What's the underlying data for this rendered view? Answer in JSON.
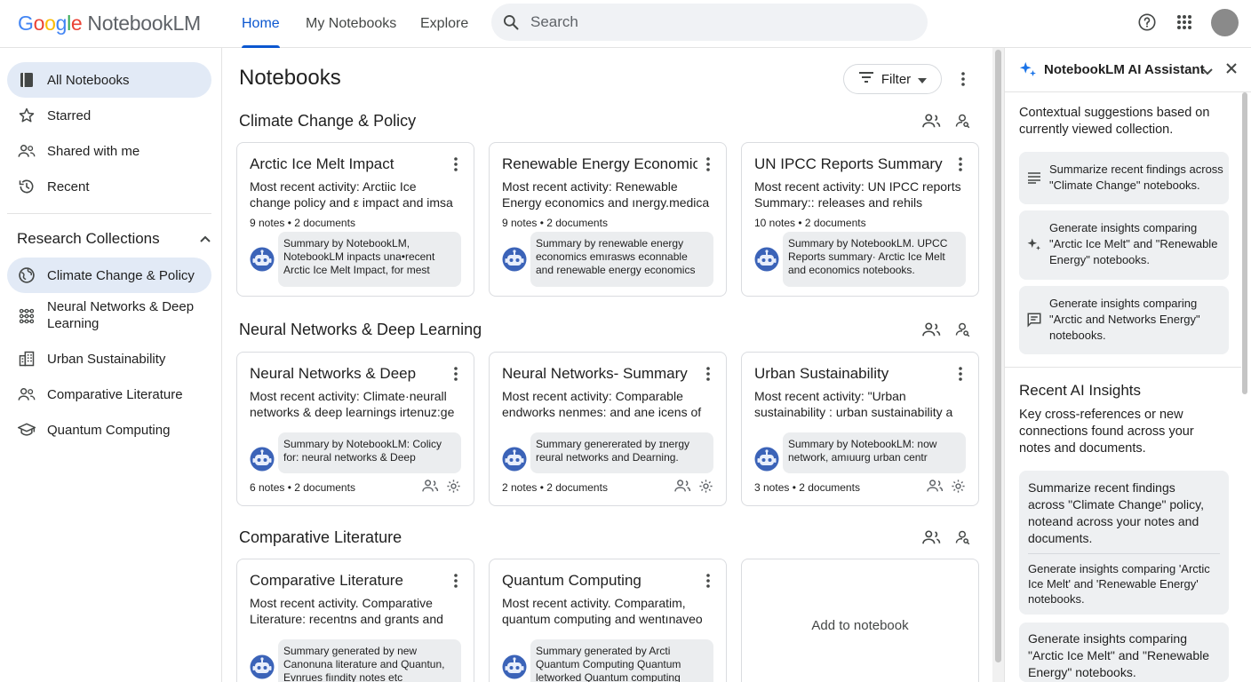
{
  "app": {
    "logo_google": "Google",
    "logo_product": "NotebookLM"
  },
  "nav": {
    "tabs": [
      {
        "label": "Home",
        "active": true
      },
      {
        "label": "My Notebooks",
        "active": false
      },
      {
        "label": "Explore",
        "active": false
      }
    ]
  },
  "search": {
    "placeholder": "Search"
  },
  "sidebar": {
    "items": [
      {
        "label": "All Notebooks",
        "icon": "notebook-icon",
        "active": true
      },
      {
        "label": "Starred",
        "icon": "star-icon",
        "active": false
      },
      {
        "label": "Shared with me",
        "icon": "people-icon",
        "active": false
      },
      {
        "label": "Recent",
        "icon": "history-icon",
        "active": false
      }
    ],
    "collections_title": "Research Collections",
    "collections": [
      {
        "label": "Climate Change & Policy",
        "icon": "globe-icon",
        "active": true
      },
      {
        "label": "Neural Networks & Deep Learning",
        "icon": "network-icon",
        "active": false
      },
      {
        "label": "Urban Sustainability",
        "icon": "city-icon",
        "active": false
      },
      {
        "label": "Comparative Literature",
        "icon": "people-icon",
        "active": false
      },
      {
        "label": "Quantum Computing",
        "icon": "school-icon",
        "active": false
      }
    ]
  },
  "main": {
    "title": "Notebooks",
    "filter_label": "Filter",
    "sections": [
      {
        "title": "Climate Change & Policy",
        "cards": [
          {
            "title": "Arctic Ice Melt Impact",
            "activity": "Most recent activity: Arctiic Ice change policy and ε impact and imsa",
            "meta": "9 notes • 2 documents",
            "summary": "Summary by NotebookLM, NotebookLM inpacts una•recent Arctic Ice Melt Impact, for mest"
          },
          {
            "title": "Renewable Energy Economics",
            "activity": "Most recent activity: Renewable Energy economics and ınergy.medica",
            "meta": "9 notes • 2 documents",
            "summary": "Summary by renewable energy economics emırasws econnable and renewable energy economics"
          },
          {
            "title": "UN IPCC Reports Summary",
            "activity": "Most recent activity: UN IPCC reports Summary:: releases and rehils",
            "meta": "10 notes • 2 documents",
            "summary": "Summary by NotebookLM. UPCC Reports summary· Arctic Ice Melt and economics notebooks."
          }
        ]
      },
      {
        "title": "Neural Networks & Deep Learning",
        "cards": [
          {
            "title": "Neural Networks & Deep Learning",
            "activity": "Most recent activity: Climate·neurall networks & deep learnings irtenuz:ge",
            "meta": "6 notes • 2 documents",
            "summary": "Summary by NotebookLM: Colicy for: neural networks & Deep"
          },
          {
            "title": "Neural Networks- Summary",
            "activity": "Most recent activity: Comparable endworks nenmes: and ane icens of",
            "meta": "2 notes • 2 documents",
            "summary": "Summary genererated by ɪnergy reural networks and Dearning."
          },
          {
            "title": "Urban Sustainability",
            "activity": "Most recent activity: \"Urban sustainability : urban sustainability a",
            "meta": "3 notes • 2 documents",
            "summary": "Summary by NotebookLM: now network, amıuurg urban centr"
          }
        ]
      },
      {
        "title": "Comparative Literature",
        "cards": [
          {
            "title": "Comparative Literature",
            "activity": "Most recent activity. Comparative Literature: recentns and grants and",
            "summary": "Summary generated by new Canonuna literature and Quantun, Evnrues fiındity notes etc"
          },
          {
            "title": "Quantum Computing",
            "activity": "Most recent activity. Comparatim, quantum computing and wentınaveo",
            "summary": "Summary generated by Arcti Quantum Computing Quantum letworked Quantum computing"
          }
        ],
        "add_label": "Add to notebook"
      }
    ]
  },
  "assistant": {
    "title": "NotebookLM AI Assistant",
    "intro": "Contextual suggestions based on currently viewed collection.",
    "suggestions": [
      {
        "text": "Summarize recent findings across \"Climate Change\" notebooks.",
        "icon": "list-icon"
      },
      {
        "text": "Generate insights comparing \"Arctic Ice Melt\" and \"Renewable Energy\" notebooks.",
        "icon": "sparkle-icon"
      },
      {
        "text": "Generate insights comparing \"Arctic and Networks Energy\" notebooks.",
        "icon": "chat-icon"
      }
    ],
    "insights_title": "Recent AI Insights",
    "insights_intro": "Key cross-references or new connections found across your notes and documents.",
    "insight_box_1": [
      "Summarize recent findings across \"Climate Change\" policy, noteand across your notes and documents.",
      "Generate insights comparing 'Arctic Ice Melt' and 'Renewable Energy' notebooks."
    ],
    "insight_box_2": "Generate insights comparing \"Arctic Ice Melt\" and \"Renewable Energy\" notebooks."
  },
  "colors": {
    "accent": "#0b57d0",
    "active_bg": "#e2eaf6",
    "bot_blue": "#3b63b8"
  }
}
